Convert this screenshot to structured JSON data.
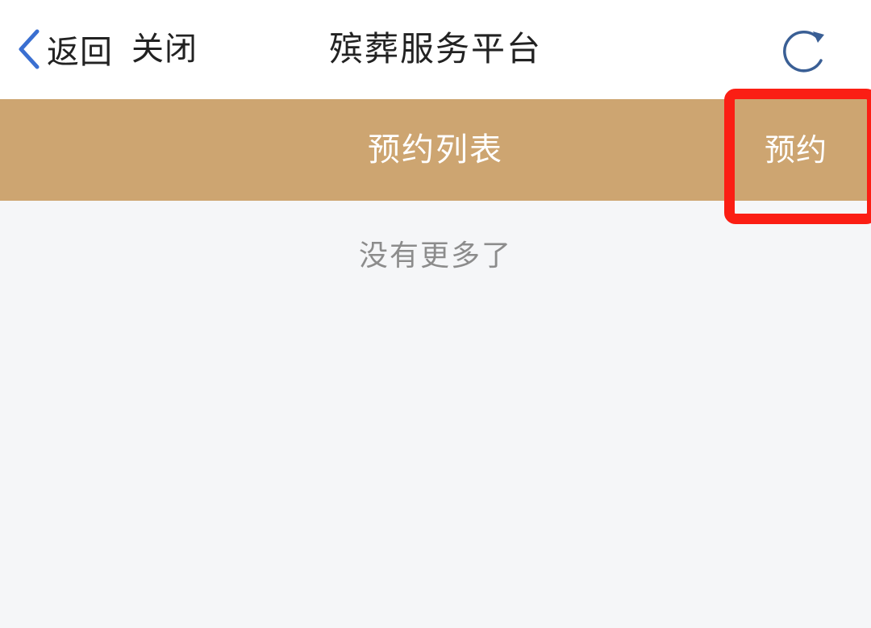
{
  "navbar": {
    "back_label": "返回",
    "close_label": "关闭",
    "title": "殡葬服务平台",
    "back_icon": "chevron-left-icon",
    "refresh_icon": "refresh-icon"
  },
  "header": {
    "title": "预约列表",
    "reserve_label": "预约"
  },
  "content": {
    "empty_message": "没有更多了"
  },
  "colors": {
    "navbar_bg": "#ffffff",
    "header_bg": "#cda571",
    "highlight_border": "#fb1e14",
    "page_bg": "#f5f6f8",
    "icon_blue": "#3a6fd1",
    "refresh_blue": "#3a5f95"
  }
}
